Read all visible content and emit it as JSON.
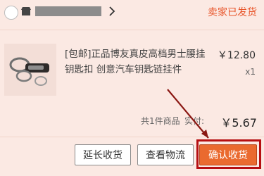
{
  "order": {
    "status": "卖家已发货",
    "store_name": ""
  },
  "product": {
    "title": "[包邮]正品博友真皮高档男士腰挂钥匙扣 创意汽车钥匙链挂件",
    "price": "￥12.80",
    "quantity": "x1"
  },
  "summary": {
    "count_text": "共1件商品",
    "paid_label": "实付:",
    "paid_amount": "￥5.67"
  },
  "actions": {
    "extend_label": "延长收货",
    "logistics_label": "查看物流",
    "confirm_label": "确认收货"
  },
  "colors": {
    "accent": "#ea6a2f",
    "status": "#e8552a",
    "highlight": "#b60f12",
    "background": "#fbe9e3"
  }
}
